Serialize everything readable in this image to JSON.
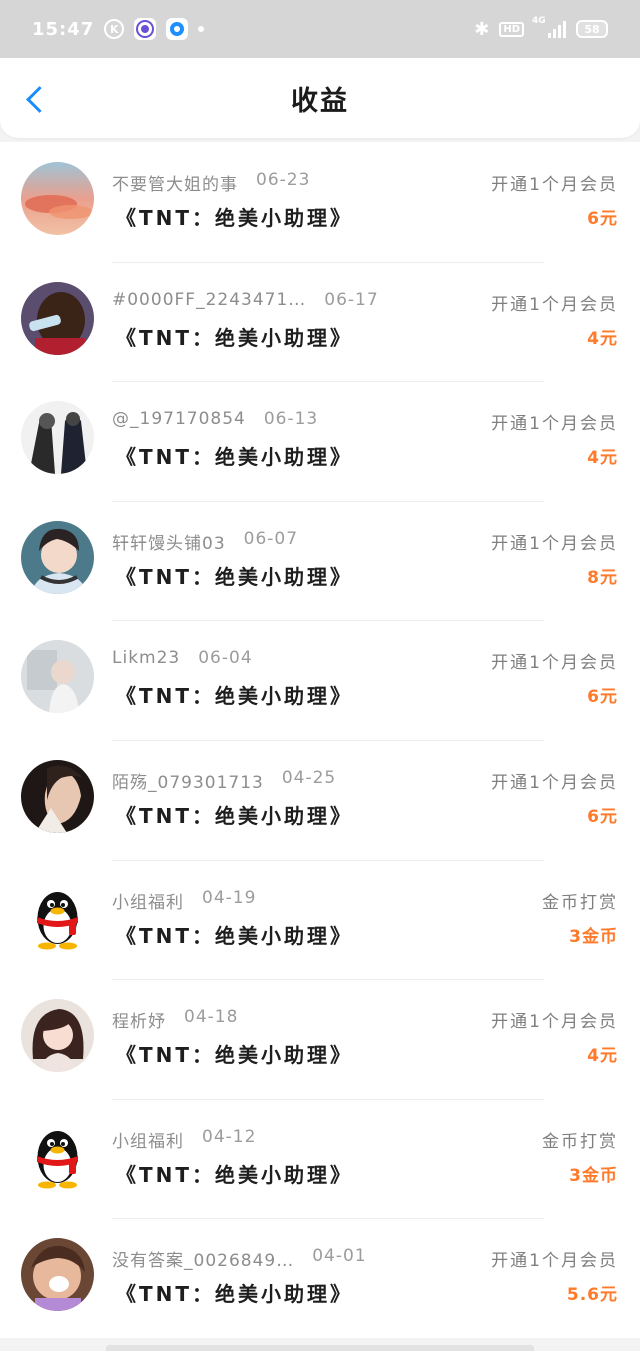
{
  "status_bar": {
    "time": "15:47",
    "k_icon": "K",
    "network": "4G",
    "battery": "58"
  },
  "header": {
    "title": "收益"
  },
  "icons": {
    "back": "chevron-left-icon",
    "bluetooth": "bluetooth-icon",
    "hd": "HD",
    "avatar_qq": "qq-penguin-icon"
  },
  "colors": {
    "accent_blue": "#1a8cff",
    "amount_orange": "#ff7a2a"
  },
  "records": [
    {
      "user": "不要管大姐的事",
      "date": "06-23",
      "product": "《TNT：绝美小助理》",
      "type": "开通1个月会员",
      "amount": "6元",
      "avatar": "sunset"
    },
    {
      "user": "#0000FF_2243471…",
      "date": "06-17",
      "product": "《TNT：绝美小助理》",
      "type": "开通1个月会员",
      "amount": "4元",
      "avatar": "man-drinking"
    },
    {
      "user": "@_197170854",
      "date": "06-13",
      "product": "《TNT：绝美小助理》",
      "type": "开通1个月会员",
      "amount": "4元",
      "avatar": "sketch"
    },
    {
      "user": "轩轩馒头铺03",
      "date": "06-07",
      "product": "《TNT：绝美小助理》",
      "type": "开通1个月会员",
      "amount": "8元",
      "avatar": "boy-headphones"
    },
    {
      "user": "Likm23",
      "date": "06-04",
      "product": "《TNT：绝美小助理》",
      "type": "开通1个月会员",
      "amount": "6元",
      "avatar": "pale-portrait"
    },
    {
      "user": "陌殇_079301713",
      "date": "04-25",
      "product": "《TNT：绝美小助理》",
      "type": "开通1个月会员",
      "amount": "6元",
      "avatar": "dark-portrait"
    },
    {
      "user": "小组福利",
      "date": "04-19",
      "product": "《TNT：绝美小助理》",
      "type": "金币打赏",
      "amount": "3金币",
      "avatar": "qq-penguin"
    },
    {
      "user": "程析妤",
      "date": "04-18",
      "product": "《TNT：绝美小助理》",
      "type": "开通1个月会员",
      "amount": "4元",
      "avatar": "girl"
    },
    {
      "user": "小组福利",
      "date": "04-12",
      "product": "《TNT：绝美小助理》",
      "type": "金币打赏",
      "amount": "3金币",
      "avatar": "qq-penguin"
    },
    {
      "user": "没有答案_0026849…",
      "date": "04-01",
      "product": "《TNT：绝美小助理》",
      "type": "开通1个月会员",
      "amount": "5.6元",
      "avatar": "funny-face"
    }
  ]
}
